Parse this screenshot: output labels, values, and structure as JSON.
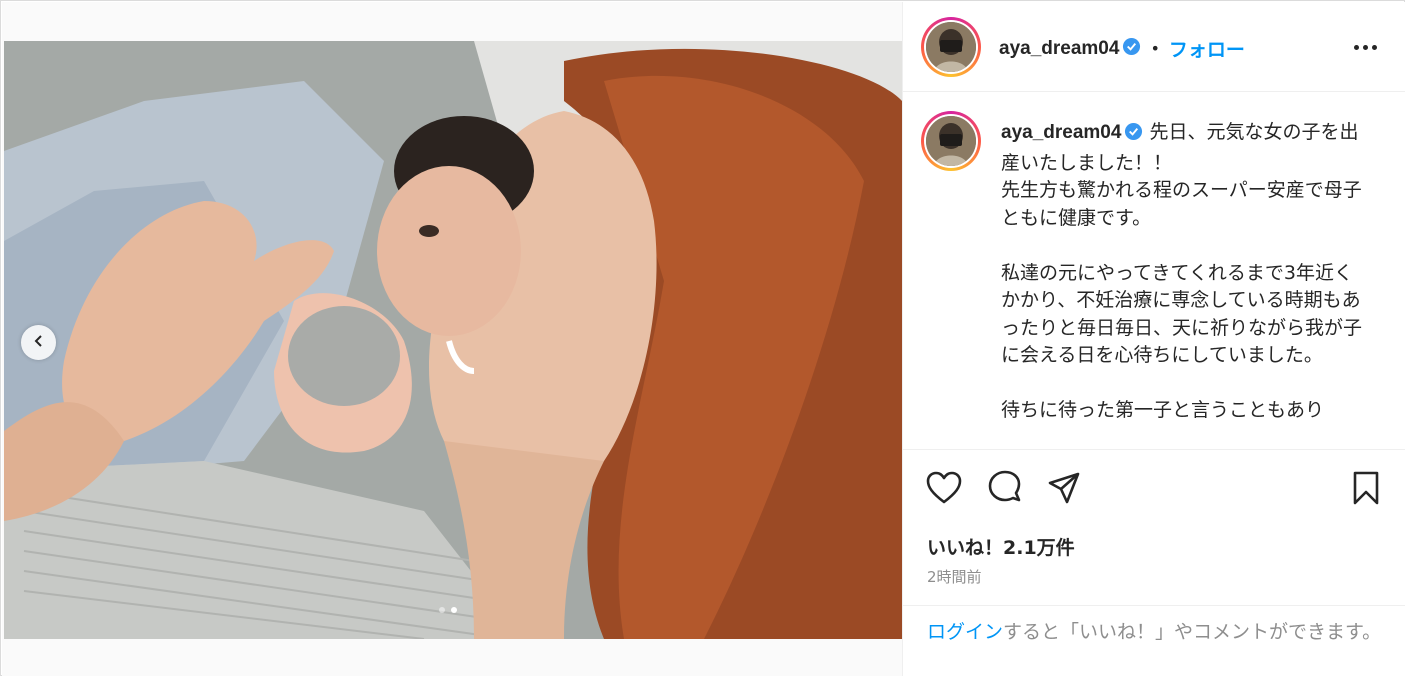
{
  "post": {
    "username": "aya_dream04",
    "follow_label": "フォロー",
    "separator": "•",
    "caption_lines": [
      "先日、元気な女の子を出産いたしました！！",
      "先生方も驚かれる程のスーパー安産で母子ともに健康です。",
      "",
      "私達の元にやってきてくれるまで3年近くかかり、不妊治療に専念している時期もあったりと毎日毎日、天に祈りながら我が子に会える日を心待ちにしていました。",
      "",
      "待ちに待った第一子と言うこともあり"
    ],
    "likes_label": "いいね！2.1万件",
    "time_label": "2時間前",
    "login_link": "ログイン",
    "login_rest": "すると「いいね！」やコメントができます。"
  },
  "carousel": {
    "total_slides": 2,
    "active_slide": 2
  },
  "icons": {
    "verified": "verified-badge-icon",
    "more": "more-options-icon",
    "like": "heart-icon",
    "comment": "comment-icon",
    "share": "paper-plane-icon",
    "save": "bookmark-icon",
    "prev": "chevron-left-icon"
  },
  "colors": {
    "link_blue": "#0095f6",
    "text": "#262626",
    "muted": "#8e8e8e",
    "verified": "#3897f0"
  }
}
